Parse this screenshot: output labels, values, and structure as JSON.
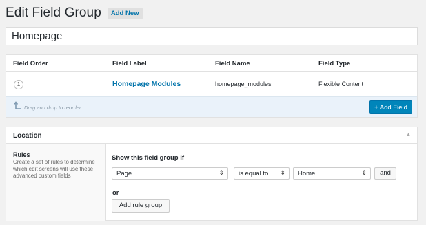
{
  "header": {
    "title": "Edit Field Group",
    "add_new_label": "Add New"
  },
  "group_title": {
    "value": "Homepage"
  },
  "fields_table": {
    "columns": [
      "Field Order",
      "Field Label",
      "Field Name",
      "Field Type"
    ],
    "rows": [
      {
        "order": "1",
        "label": "Homepage Modules",
        "name": "homepage_modules",
        "type": "Flexible Content"
      }
    ],
    "drag_hint": "Drag and drop to reorder",
    "add_field_label": "+ Add Field"
  },
  "location": {
    "title": "Location",
    "rules_title": "Rules",
    "rules_desc": "Create a set of rules to determine which edit screens will use these advanced custom fields",
    "show_if": "Show this field group if",
    "param_value": "Page",
    "operator_value": "is equal to",
    "value_value": "Home",
    "and_label": "and",
    "or_label": "or",
    "add_rule_group_label": "Add rule group"
  },
  "colors": {
    "accent": "#0073aa",
    "primary_button": "#0085ba",
    "footer_bar": "#eaf2fa"
  }
}
